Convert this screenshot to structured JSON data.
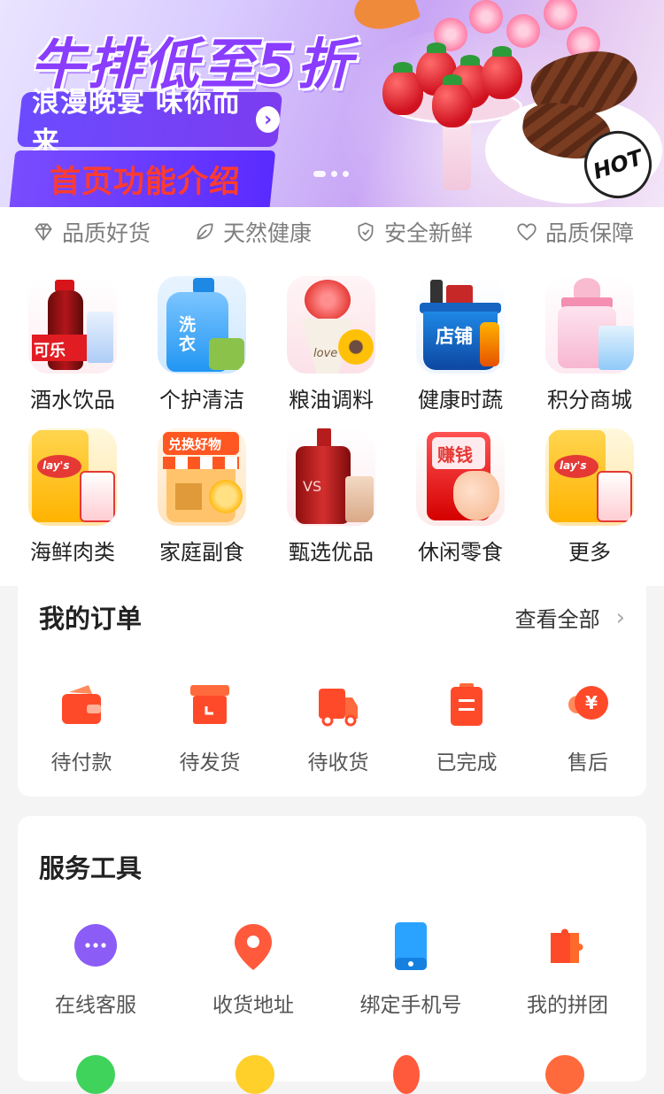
{
  "banner": {
    "headline": "牛排低至5折",
    "subline": "浪漫晚宴 味你而来",
    "intro_label": "首页功能介绍",
    "badge_text": "HOT",
    "slide_count": 3,
    "active_slide": 0
  },
  "features": [
    {
      "icon": "diamond-icon",
      "label": "品质好货"
    },
    {
      "icon": "leaf-icon",
      "label": "天然健康"
    },
    {
      "icon": "shield-check-icon",
      "label": "安全新鲜"
    },
    {
      "icon": "heart-icon",
      "label": "品质保障"
    }
  ],
  "categories": [
    {
      "label": "酒水饮品",
      "icon": "cola-bottle-icon"
    },
    {
      "label": "个护清洁",
      "icon": "detergent-icon"
    },
    {
      "label": "粮油调料",
      "icon": "flower-bouquet-icon"
    },
    {
      "label": "健康时蔬",
      "icon": "shopping-basket-icon"
    },
    {
      "label": "积分商城",
      "icon": "baby-bottle-icon"
    },
    {
      "label": "海鲜肉类",
      "icon": "chips-icon"
    },
    {
      "label": "家庭副食",
      "icon": "shop-exchange-icon"
    },
    {
      "label": "甄选优品",
      "icon": "cosmetics-icon"
    },
    {
      "label": "休闲零食",
      "icon": "red-envelope-icon"
    },
    {
      "label": "更多",
      "icon": "chips-icon"
    }
  ],
  "orders": {
    "title": "我的订单",
    "view_all": "查看全部",
    "items": [
      {
        "label": "待付款",
        "icon": "wallet-icon"
      },
      {
        "label": "待发货",
        "icon": "box-icon"
      },
      {
        "label": "待收货",
        "icon": "truck-icon"
      },
      {
        "label": "已完成",
        "icon": "clipboard-icon"
      },
      {
        "label": "售后",
        "icon": "yen-refund-icon"
      }
    ]
  },
  "services": {
    "title": "服务工具",
    "items": [
      {
        "label": "在线客服",
        "icon": "chat-icon"
      },
      {
        "label": "收货地址",
        "icon": "location-pin-icon"
      },
      {
        "label": "绑定手机号",
        "icon": "phone-icon"
      },
      {
        "label": "我的拼团",
        "icon": "puzzle-icon"
      }
    ]
  },
  "colors": {
    "accent_red": "#ff4a2a",
    "orange": "#ff6a2b",
    "purple": "#7a4cff",
    "blue": "#2aa2ff"
  }
}
